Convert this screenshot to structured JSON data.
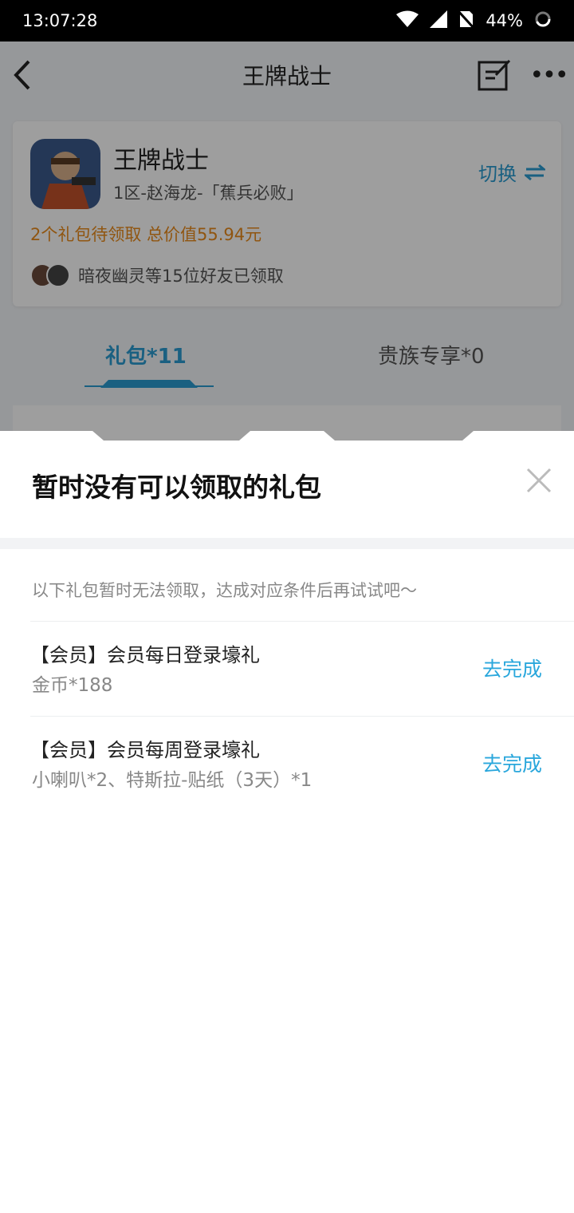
{
  "status_bar": {
    "time": "13:07:28",
    "battery": "44%",
    "icons": [
      "wifi-icon",
      "cellular-signal-icon",
      "no-sim-icon",
      "battery-icon"
    ]
  },
  "header": {
    "title": "王牌战士",
    "back_icon": "chevron-left-icon",
    "edit_icon": "edit-icon",
    "more_icon": "more-icon",
    "more_label": "•••"
  },
  "game_card": {
    "name": "王牌战士",
    "account": "1区-赵海龙-「蕉兵必败」",
    "switch_label": "切换",
    "gift_summary": "2个礼包待领取 总价值55.94元",
    "friends_text": "暗夜幽灵等15位好友已领取"
  },
  "tabs": [
    {
      "label": "礼包*11",
      "active": true
    },
    {
      "label": "贵族专享*0",
      "active": false
    }
  ],
  "sheet": {
    "title": "暂时没有可以领取的礼包",
    "hint": "以下礼包暂时无法领取，达成对应条件后再试试吧～",
    "items": [
      {
        "name": "【会员】会员每日登录壕礼",
        "desc": "金币*188",
        "action": "去完成"
      },
      {
        "name": "【会员】会员每周登录壕礼",
        "desc": "小喇叭*2、特斯拉-贴纸（3天）*1",
        "action": "去完成"
      }
    ]
  },
  "colors": {
    "accent": "#2aa7dc",
    "orange": "#e88a1a",
    "dim_overlay": "rgba(0,0,0,0.38)"
  }
}
